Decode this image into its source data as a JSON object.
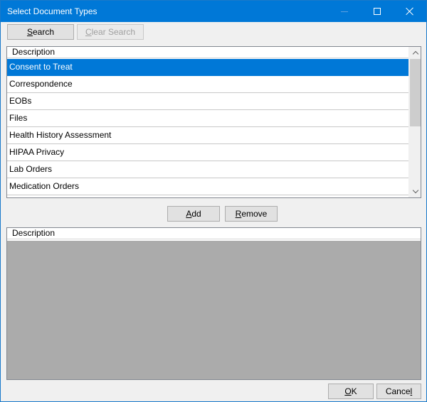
{
  "window": {
    "title": "Select Document Types"
  },
  "toolbar": {
    "search_label": "Search",
    "search_mnemonic": "S",
    "search_rest": "earch",
    "clear_search_label": "Clear Search",
    "clear_mnemonic": "C",
    "clear_rest": "lear Search"
  },
  "available_grid": {
    "column_header": "Description",
    "rows": [
      {
        "description": "Consent to Treat",
        "selected": true
      },
      {
        "description": "Correspondence",
        "selected": false
      },
      {
        "description": "EOBs",
        "selected": false
      },
      {
        "description": "Files",
        "selected": false
      },
      {
        "description": "Health History Assessment",
        "selected": false
      },
      {
        "description": "HIPAA Privacy",
        "selected": false
      },
      {
        "description": "Lab Orders",
        "selected": false
      },
      {
        "description": "Medication Orders",
        "selected": false
      }
    ]
  },
  "actions": {
    "add_label": "Add",
    "add_mnemonic": "A",
    "add_rest": "dd",
    "remove_label": "Remove",
    "remove_mnemonic": "R",
    "remove_rest": "emove"
  },
  "selected_grid": {
    "column_header": "Description",
    "rows": []
  },
  "footer": {
    "ok_label": "OK",
    "ok_mnemonic": "O",
    "ok_rest": "K",
    "cancel_label": "Cancel",
    "cancel_mnemonic": "l",
    "cancel_prefix": "Cance"
  },
  "colors": {
    "titlebar": "#0078d7",
    "selection": "#0078d7",
    "empty_grid": "#ababab"
  }
}
